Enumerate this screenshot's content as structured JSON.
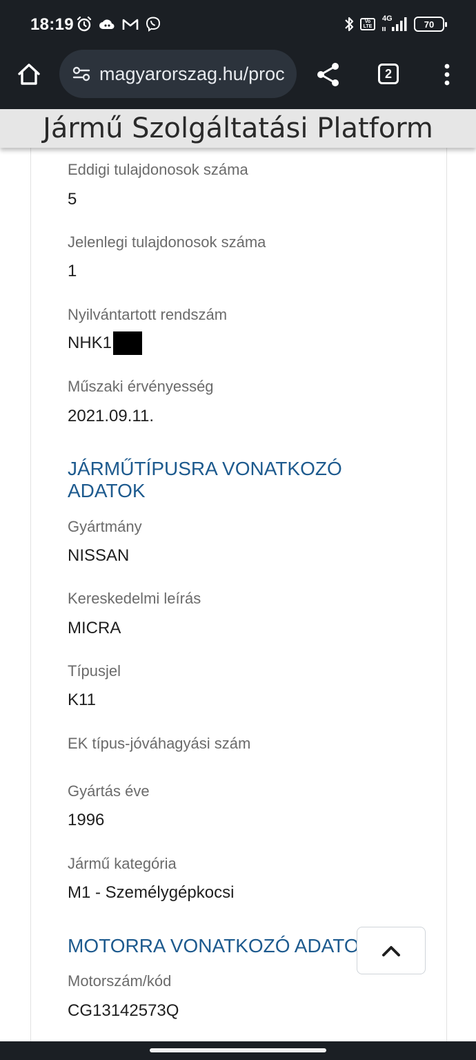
{
  "status_bar": {
    "time": "18:19",
    "left_icons": [
      "alarm-icon",
      "cloud-game-icon",
      "gmail-icon",
      "viber-icon"
    ],
    "right_icons": [
      "bluetooth-icon",
      "volte-icon",
      "signal-4g-icon"
    ],
    "network_label": "4G",
    "volte_label_top": "Vo",
    "volte_label_bottom": "LTE",
    "battery": "70"
  },
  "browser": {
    "url": "magyarorszag.hu/proc",
    "tab_count": "2"
  },
  "header": {
    "title": "Jármű Szolgáltatási Platform"
  },
  "fields_top": [
    {
      "label": "Eddigi tulajdonosok száma",
      "value": "5"
    },
    {
      "label": "Jelenlegi tulajdonosok száma",
      "value": "1"
    },
    {
      "label": "Nyilvántartott rendszám",
      "value": "NHK1"
    },
    {
      "label": "Műszaki érvényesség",
      "value": "2021.09.11."
    }
  ],
  "section_vehicle_type": {
    "title_line1": "JÁRMŰTÍPUSRA VONATKOZÓ",
    "title_line2": "ADATOK",
    "fields": [
      {
        "label": "Gyártmány",
        "value": "NISSAN"
      },
      {
        "label": "Kereskedelmi leírás",
        "value": "MICRA"
      },
      {
        "label": "Típusjel",
        "value": "K11"
      },
      {
        "label": "EK típus-jóváhagyási szám",
        "value": ""
      },
      {
        "label": "Gyártás éve",
        "value": "1996"
      },
      {
        "label": "Jármű kategória",
        "value": "M1 - Személygépkocsi"
      }
    ]
  },
  "section_engine": {
    "title": "MOTORRA VONATKOZÓ ADATO",
    "fields": [
      {
        "label": "Motorszám/kód",
        "value": "CG13142573Q"
      }
    ]
  },
  "colors": {
    "system_bar": "#1b1f24",
    "section_title": "#1d5a8e",
    "label": "#6b6b6b",
    "value": "#1f1f1f",
    "header_bg": "#e6e6e6"
  }
}
